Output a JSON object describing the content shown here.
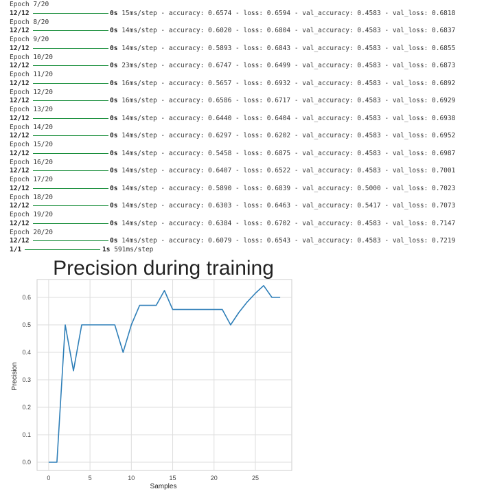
{
  "log": [
    {
      "type": "epoch",
      "text": "Epoch 7/20"
    },
    {
      "type": "step",
      "count": "12/12",
      "time": "0s",
      "metrics": "15ms/step - accuracy: 0.6574 - loss: 0.6594 - val_accuracy: 0.4583 - val_loss: 0.6818"
    },
    {
      "type": "epoch",
      "text": "Epoch 8/20"
    },
    {
      "type": "step",
      "count": "12/12",
      "time": "0s",
      "metrics": "14ms/step - accuracy: 0.6020 - loss: 0.6804 - val_accuracy: 0.4583 - val_loss: 0.6837"
    },
    {
      "type": "epoch",
      "text": "Epoch 9/20"
    },
    {
      "type": "step",
      "count": "12/12",
      "time": "0s",
      "metrics": "14ms/step - accuracy: 0.5893 - loss: 0.6843 - val_accuracy: 0.4583 - val_loss: 0.6855"
    },
    {
      "type": "epoch",
      "text": "Epoch 10/20"
    },
    {
      "type": "step",
      "count": "12/12",
      "time": "0s",
      "metrics": "23ms/step - accuracy: 0.6747 - loss: 0.6499 - val_accuracy: 0.4583 - val_loss: 0.6873"
    },
    {
      "type": "epoch",
      "text": "Epoch 11/20"
    },
    {
      "type": "step",
      "count": "12/12",
      "time": "0s",
      "metrics": "16ms/step - accuracy: 0.5657 - loss: 0.6932 - val_accuracy: 0.4583 - val_loss: 0.6892"
    },
    {
      "type": "epoch",
      "text": "Epoch 12/20"
    },
    {
      "type": "step",
      "count": "12/12",
      "time": "0s",
      "metrics": "16ms/step - accuracy: 0.6586 - loss: 0.6717 - val_accuracy: 0.4583 - val_loss: 0.6929"
    },
    {
      "type": "epoch",
      "text": "Epoch 13/20"
    },
    {
      "type": "step",
      "count": "12/12",
      "time": "0s",
      "metrics": "14ms/step - accuracy: 0.6440 - loss: 0.6404 - val_accuracy: 0.4583 - val_loss: 0.6938"
    },
    {
      "type": "epoch",
      "text": "Epoch 14/20"
    },
    {
      "type": "step",
      "count": "12/12",
      "time": "0s",
      "metrics": "14ms/step - accuracy: 0.6297 - loss: 0.6202 - val_accuracy: 0.4583 - val_loss: 0.6952"
    },
    {
      "type": "epoch",
      "text": "Epoch 15/20"
    },
    {
      "type": "step",
      "count": "12/12",
      "time": "0s",
      "metrics": "14ms/step - accuracy: 0.5458 - loss: 0.6875 - val_accuracy: 0.4583 - val_loss: 0.6987"
    },
    {
      "type": "epoch",
      "text": "Epoch 16/20"
    },
    {
      "type": "step",
      "count": "12/12",
      "time": "0s",
      "metrics": "14ms/step - accuracy: 0.6407 - loss: 0.6522 - val_accuracy: 0.4583 - val_loss: 0.7001"
    },
    {
      "type": "epoch",
      "text": "Epoch 17/20"
    },
    {
      "type": "step",
      "count": "12/12",
      "time": "0s",
      "metrics": "14ms/step - accuracy: 0.5890 - loss: 0.6839 - val_accuracy: 0.5000 - val_loss: 0.7023"
    },
    {
      "type": "epoch",
      "text": "Epoch 18/20"
    },
    {
      "type": "step",
      "count": "12/12",
      "time": "0s",
      "metrics": "14ms/step - accuracy: 0.6303 - loss: 0.6463 - val_accuracy: 0.5417 - val_loss: 0.7073"
    },
    {
      "type": "epoch",
      "text": "Epoch 19/20"
    },
    {
      "type": "step",
      "count": "12/12",
      "time": "0s",
      "metrics": "14ms/step - accuracy: 0.6384 - loss: 0.6702 - val_accuracy: 0.4583 - val_loss: 0.7147"
    },
    {
      "type": "epoch",
      "text": "Epoch 20/20"
    },
    {
      "type": "step",
      "count": "12/12",
      "time": "0s",
      "metrics": "14ms/step - accuracy: 0.6079 - loss: 0.6543 - val_accuracy: 0.4583 - val_loss: 0.7219"
    },
    {
      "type": "predict",
      "count": "1/1",
      "time": "1s",
      "metrics": "591ms/step"
    }
  ],
  "colors": {
    "progress_bar": "#1a8f3c",
    "line": "#2f7fb8",
    "grid": "#dddddd"
  },
  "chart_data": {
    "type": "line",
    "title": "Precision during training",
    "xlabel": "Samples",
    "ylabel": "Precision",
    "xlim": [
      -1.4,
      29.4
    ],
    "ylim": [
      -0.03,
      0.665
    ],
    "xticks": [
      0,
      5,
      10,
      15,
      20,
      25
    ],
    "yticks": [
      0.0,
      0.1,
      0.2,
      0.3,
      0.4,
      0.5,
      0.6
    ],
    "ytick_labels": [
      "0.0",
      "0.1",
      "0.2",
      "0.3",
      "0.4",
      "0.5",
      "0.6"
    ],
    "grid": true,
    "series": [
      {
        "x": [
          0,
          1,
          2,
          3,
          4,
          5,
          6,
          7,
          8,
          9,
          10,
          11,
          12,
          13,
          14,
          15,
          16,
          17,
          18,
          19,
          20,
          21,
          22,
          23,
          24,
          25,
          26,
          27,
          28
        ],
        "values": [
          0,
          0,
          0.5,
          0.333,
          0.5,
          0.5,
          0.5,
          0.5,
          0.5,
          0.4,
          0.5,
          0.571,
          0.571,
          0.571,
          0.625,
          0.556,
          0.556,
          0.556,
          0.556,
          0.556,
          0.556,
          0.556,
          0.5,
          0.545,
          0.583,
          0.615,
          0.643,
          0.6,
          0.6
        ]
      }
    ]
  }
}
